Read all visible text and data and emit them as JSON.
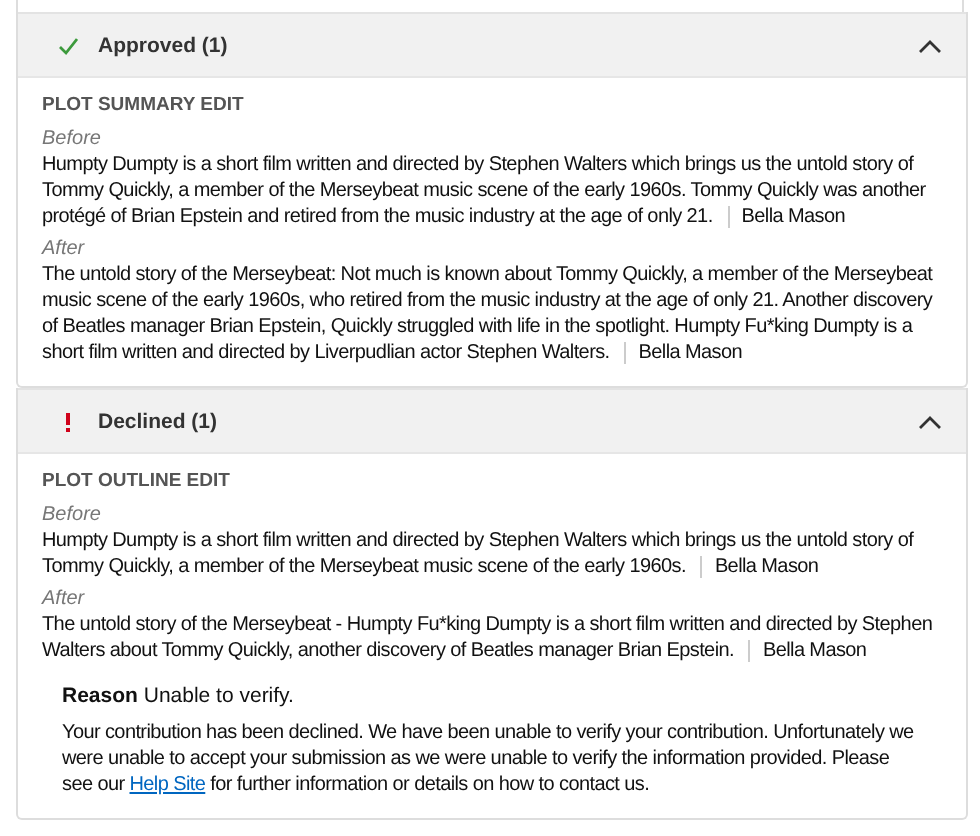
{
  "sections": [
    {
      "kind": "approved",
      "title": "Approved (1)",
      "expanded": true,
      "edits": [
        {
          "field": "PLOT SUMMARY EDIT",
          "before_label": "Before",
          "before": "Humpty Dumpty is a short film written and directed by Stephen Walters which brings us the untold story of Tommy Quickly, a member of the Merseybeat music scene of the early 1960s. Tommy Quickly was another protégé of Brian Epstein and retired from the music industry at the age of only 21.",
          "before_author": "Bella Mason",
          "after_label": "After",
          "after": "The untold story of the Merseybeat: Not much is known about Tommy Quickly, a member of the Merseybeat music scene of the early 1960s, who retired from the music industry at the age of only 21. Another discovery of Beatles manager Brian Epstein, Quickly struggled with life in the spotlight. Humpty Fu*king Dumpty is a short film written and directed by Liverpudlian actor Stephen Walters.",
          "after_author": "Bella Mason"
        }
      ]
    },
    {
      "kind": "declined",
      "title": "Declined (1)",
      "expanded": true,
      "edits": [
        {
          "field": "PLOT OUTLINE EDIT",
          "before_label": "Before",
          "before": "Humpty Dumpty is a short film written and directed by Stephen Walters which brings us the untold story of Tommy Quickly, a member of the Merseybeat music scene of the early 1960s.",
          "before_author": "Bella Mason",
          "after_label": "After",
          "after": "The untold story of the Merseybeat - Humpty Fu*king Dumpty is a short film written and directed by Stephen Walters about Tommy Quickly, another discovery of Beatles manager Brian Epstein.",
          "after_author": "Bella Mason",
          "reason_label": "Reason",
          "reason": "Unable to verify.",
          "message_start": "Your contribution has been declined.  We have been unable to verify your contribution. Unfortunately we were unable to accept your submission as we were unable to verify the information provided. Please see our",
          "message_link": "Help Site",
          "message_end": "for further information or details on how to contact us."
        }
      ]
    }
  ]
}
